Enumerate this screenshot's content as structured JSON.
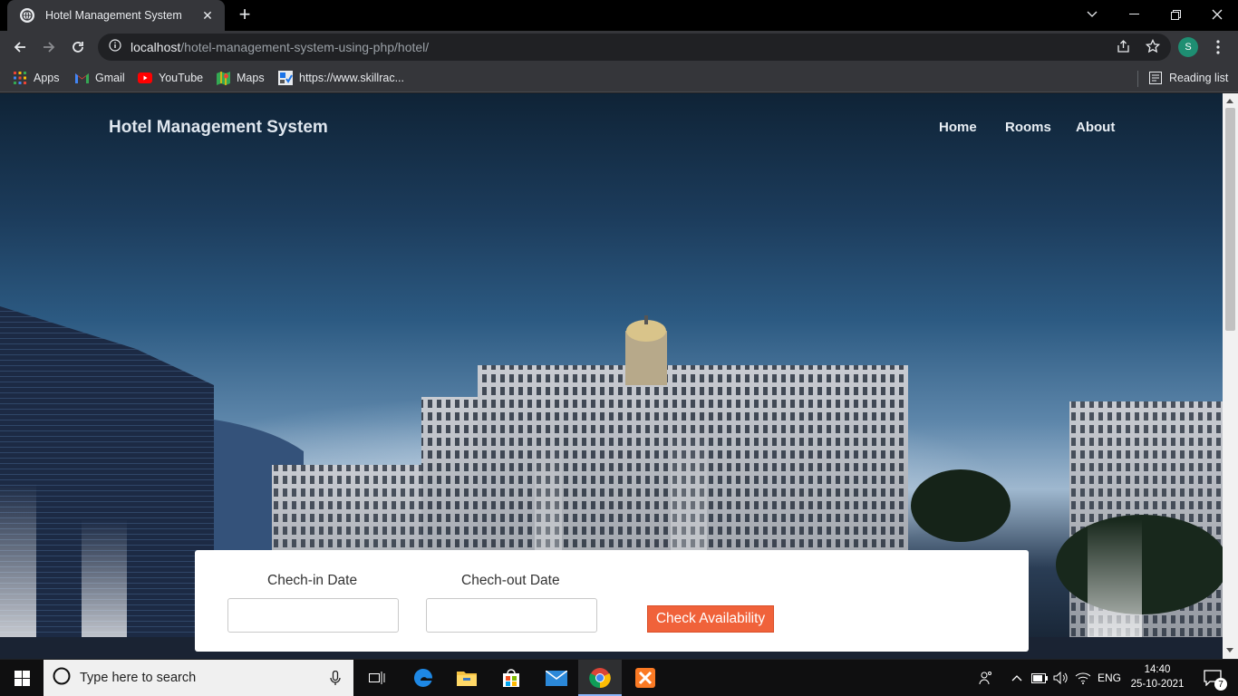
{
  "browser": {
    "tab_title": "Hotel Management System",
    "url_host": "localhost",
    "url_path": "/hotel-management-system-using-php/hotel/",
    "profile_initial": "S",
    "bookmarks": [
      {
        "label": "Apps",
        "icon": "apps-grid-icon"
      },
      {
        "label": "Gmail",
        "icon": "gmail-icon"
      },
      {
        "label": "YouTube",
        "icon": "youtube-icon"
      },
      {
        "label": "Maps",
        "icon": "maps-icon"
      },
      {
        "label": "https://www.skillrac...",
        "icon": "skillrack-icon"
      }
    ],
    "reading_list": "Reading list"
  },
  "site": {
    "brand": "Hotel Management System",
    "nav": [
      "Home",
      "Rooms",
      "About"
    ]
  },
  "booking": {
    "checkin_label": "Chech-in Date",
    "checkout_label": "Chech-out Date",
    "checkin_value": "",
    "checkout_value": "",
    "button_label": "Check Availability",
    "button_color": "#f0623a"
  },
  "taskbar": {
    "search_placeholder": "Type here to search",
    "language": "ENG",
    "time": "14:40",
    "date": "25-10-2021",
    "notifications": "7"
  }
}
